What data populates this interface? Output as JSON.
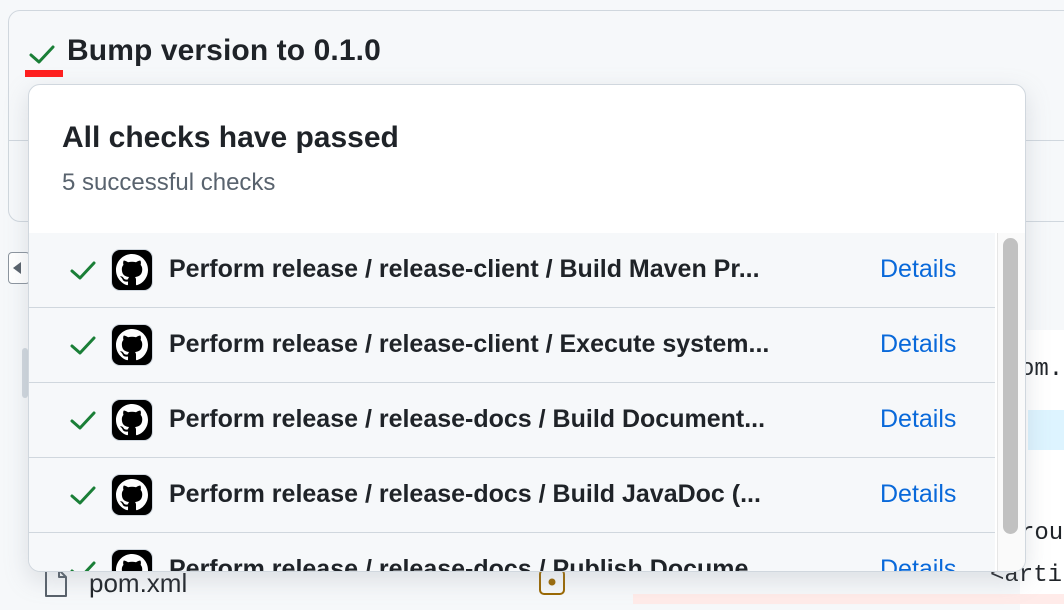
{
  "commit": {
    "title": "Bump version to 0.1.0",
    "status_icon": "check-icon",
    "status_color": "#1a7f37"
  },
  "popover": {
    "title": "All checks have passed",
    "subtitle": "5 successful checks",
    "checks": [
      {
        "label": "Perform release / release-client / Build Maven Pr...",
        "details": "Details",
        "status": "success",
        "icon": "github-icon"
      },
      {
        "label": "Perform release / release-client / Execute system...",
        "details": "Details",
        "status": "success",
        "icon": "github-icon"
      },
      {
        "label": "Perform release / release-docs / Build Document...",
        "details": "Details",
        "status": "success",
        "icon": "github-icon"
      },
      {
        "label": "Perform release / release-docs / Build JavaDoc (...",
        "details": "Details",
        "status": "success",
        "icon": "github-icon"
      },
      {
        "label": "Perform release / release-docs / Publish Docume...",
        "details": "Details",
        "status": "success",
        "icon": "github-icon"
      }
    ]
  },
  "background": {
    "file_name": "pom.xml",
    "code_fragments": [
      "om.x",
      "rou",
      "<arti"
    ]
  },
  "colors": {
    "link": "#0969da",
    "success": "#1a7f37",
    "border": "#d0d7de",
    "highlight": "#ff1f1f"
  }
}
